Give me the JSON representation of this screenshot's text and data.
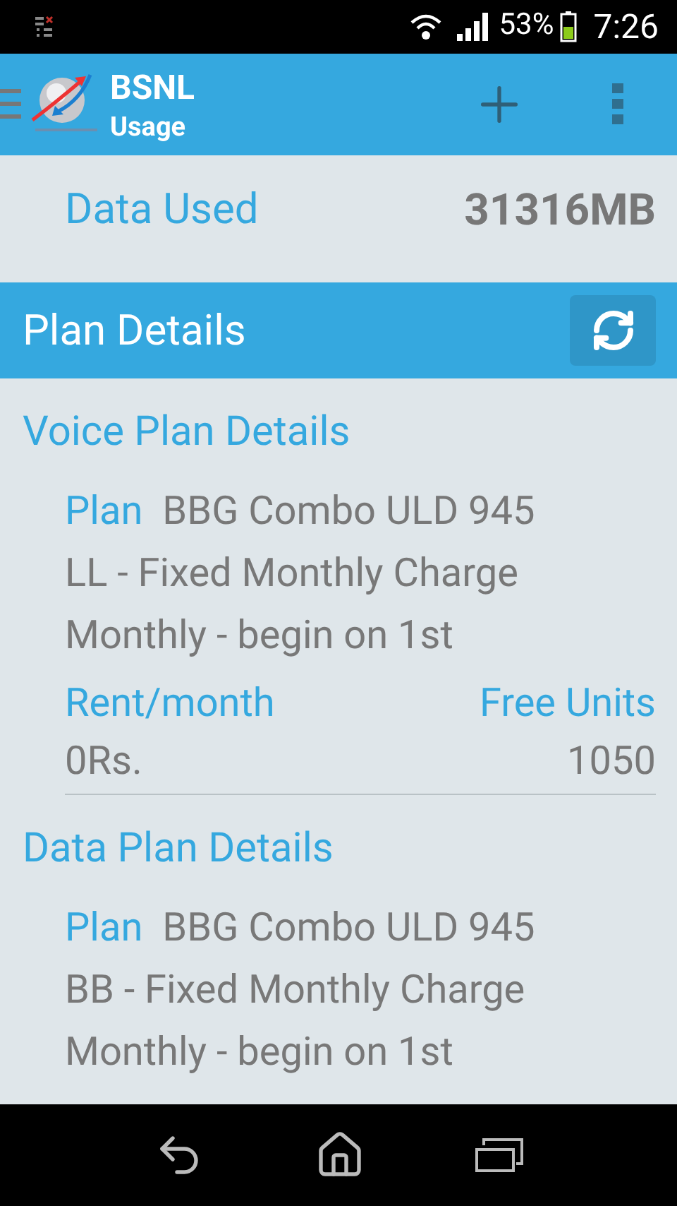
{
  "status_bar": {
    "battery": "53%",
    "time": "7:26"
  },
  "app_bar": {
    "title": "BSNL",
    "subtitle": "Usage"
  },
  "data_used": {
    "label": "Data Used",
    "value": "31316MB"
  },
  "plan_section": {
    "title": "Plan Details"
  },
  "plans": [
    {
      "heading": "Voice Plan Details",
      "plan_label": "Plan",
      "plan_lines": [
        "BBG Combo ULD 945",
        "LL - Fixed Monthly Charge",
        "Monthly - begin on 1st"
      ],
      "rent_label": "Rent/month",
      "free_units_label": "Free Units",
      "rent": "0Rs.",
      "free_units": "1050"
    },
    {
      "heading": "Data Plan Details",
      "plan_label": "Plan",
      "plan_lines": [
        "BBG Combo ULD 945",
        "BB - Fixed Monthly Charge",
        "Monthly - begin on 1st"
      ]
    }
  ]
}
